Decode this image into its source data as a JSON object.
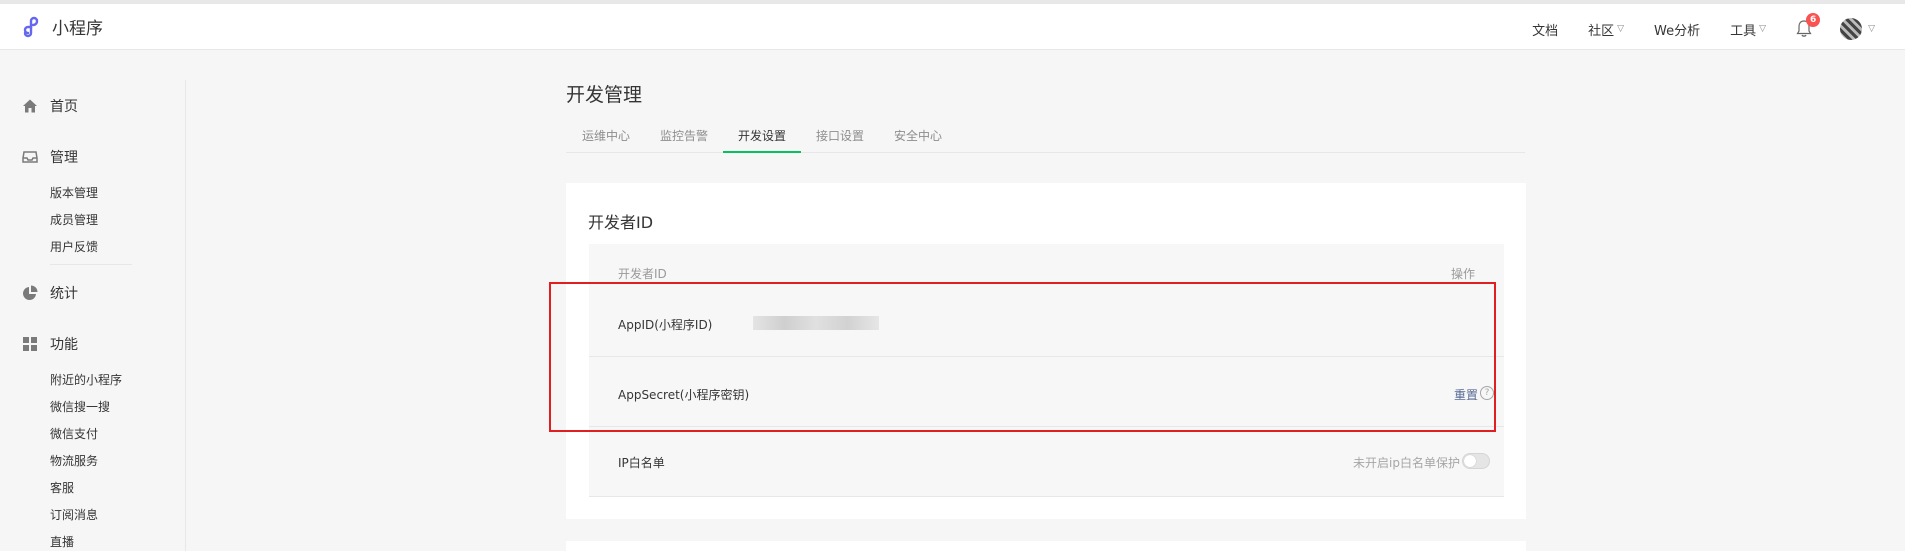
{
  "header": {
    "brand_name": "小程序",
    "nav": [
      {
        "label": "文档",
        "has_caret": false
      },
      {
        "label": "社区",
        "has_caret": true
      },
      {
        "label": "We分析",
        "has_caret": false
      },
      {
        "label": "工具",
        "has_caret": true
      }
    ],
    "notification_count": "6",
    "accent_color": "#07c160",
    "badge_color": "#fa5151"
  },
  "sidebar": {
    "home": {
      "label": "首页",
      "icon": "home-icon"
    },
    "manage": {
      "label": "管理",
      "icon": "inbox-icon"
    },
    "manage_items": [
      "版本管理",
      "成员管理",
      "用户反馈"
    ],
    "stats": {
      "label": "统计",
      "icon": "pie-chart-icon"
    },
    "features": {
      "label": "功能",
      "icon": "grid-icon"
    },
    "feature_items": [
      "附近的小程序",
      "微信搜一搜",
      "微信支付",
      "物流服务",
      "客服",
      "订阅消息",
      "直播"
    ]
  },
  "main": {
    "title": "开发管理",
    "tabs": [
      "运维中心",
      "监控告警",
      "开发设置",
      "接口设置",
      "安全中心"
    ],
    "active_tab": "开发设置",
    "card": {
      "title": "开发者ID",
      "columns": {
        "id": "开发者ID",
        "action": "操作"
      },
      "rows": {
        "appid_label": "AppID(小程序ID)",
        "appsecret_label": "AppSecret(小程序密钥)",
        "appsecret_action": "重置",
        "ip_label": "IP白名单",
        "ip_status": "未开启ip白名单保护"
      }
    }
  },
  "annotation": {
    "highlight_color": "#e02020"
  }
}
